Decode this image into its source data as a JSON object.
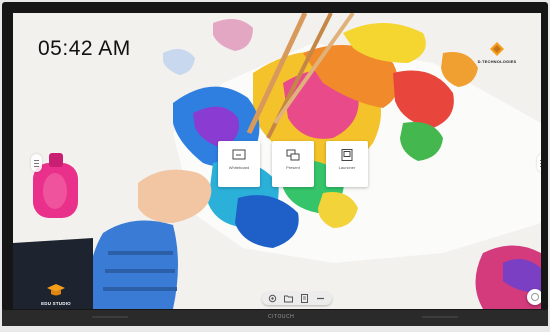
{
  "screen": {
    "clock": "05:42 AM"
  },
  "brand": {
    "name": "D.TECHNOLOGIES"
  },
  "apps": [
    {
      "label": "Whiteboard",
      "icon": "whiteboard-icon"
    },
    {
      "label": "Present",
      "icon": "present-icon"
    },
    {
      "label": "Launcher",
      "icon": "launcher-icon"
    }
  ],
  "edu_studio": {
    "label": "EDU STUDIO"
  },
  "taskbar": {
    "icons": [
      "settings-icon",
      "folder-icon",
      "document-icon",
      "more-icon"
    ]
  },
  "device": {
    "bottom_brand": "CITOUCH"
  },
  "colors": {
    "accent_orange": "#f59e1a",
    "bezel": "#161616"
  }
}
